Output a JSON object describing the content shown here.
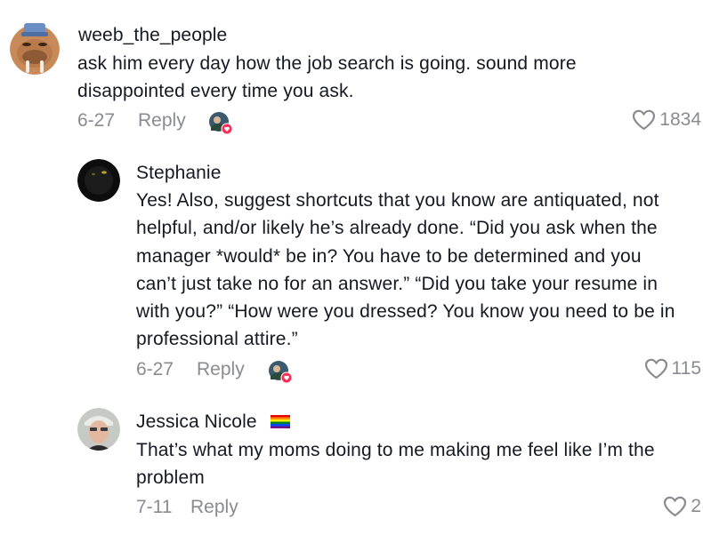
{
  "comments": [
    {
      "username": "weeb_the_people",
      "lines": [
        "ask him every day how the job search is going. sound more",
        "disappointed every time you ask."
      ],
      "date": "6-27",
      "reply_label": "Reply",
      "likes": "1834",
      "avatar_icon": "walrus-avatar",
      "liked_by_creator": true
    },
    {
      "username": "Stephanie",
      "lines": [
        "Yes! Also, suggest shortcuts that you know are antiquated, not",
        "helpful, and/or likely he’s already done. “Did you ask when the",
        "manager *would* be in? You have to be determined and you",
        "can’t just take no for an answer.” “Did you take your resume in",
        "with you?” “How were you dressed? You know you need to be in",
        "professional attire.”"
      ],
      "date": "6-27",
      "reply_label": "Reply",
      "likes": "115",
      "avatar_icon": "dark-cat-avatar",
      "liked_by_creator": true
    },
    {
      "username": "Jessica Nicole",
      "username_badge": "rainbow-flag-icon",
      "lines": [
        "That’s what my moms doing to me making me feel like I’m the",
        "problem"
      ],
      "date": "7-11",
      "reply_label": "Reply",
      "likes": "2",
      "avatar_icon": "person-avatar",
      "liked_by_creator": false
    }
  ],
  "colors": {
    "text": "#161823",
    "secondary": "#8a8b91",
    "creator_heart": "#fe2c55"
  }
}
